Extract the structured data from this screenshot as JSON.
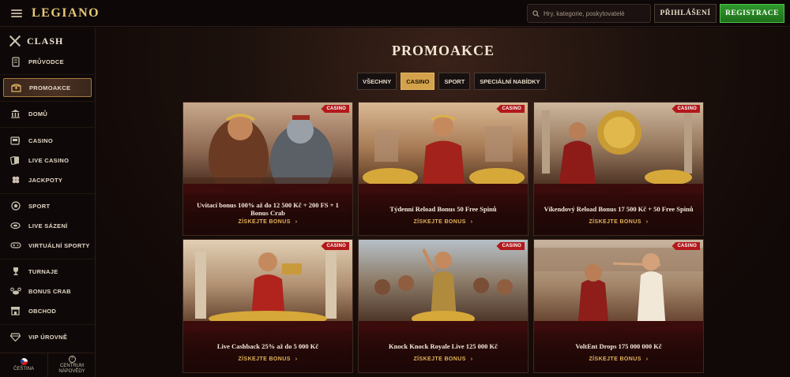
{
  "header": {
    "logo": "LEGIANO",
    "search_placeholder": "Hry, kategorie, poskytovatelé",
    "login_label": "PŘIHLÁŠENÍ",
    "register_label": "REGISTRACE"
  },
  "sidebar": {
    "clash_label": "CLASH",
    "items": [
      {
        "label": "PRŮVODCE",
        "icon": "scroll-icon"
      },
      {
        "label": "PROMOAKCE",
        "icon": "treasure-chest-icon"
      },
      {
        "label": "DOMŮ",
        "icon": "temple-icon"
      },
      {
        "label": "CASINO",
        "icon": "slot-machine-icon"
      },
      {
        "label": "LIVE CASINO",
        "icon": "cards-icon"
      },
      {
        "label": "JACKPOTY",
        "icon": "clover-icon"
      },
      {
        "label": "SPORT",
        "icon": "ball-icon"
      },
      {
        "label": "LIVE SÁZENÍ",
        "icon": "live-stadium-icon"
      },
      {
        "label": "VIRTUÁLNÍ SPORTY",
        "icon": "gamepad-icon"
      },
      {
        "label": "TURNAJE",
        "icon": "trophy-icon"
      },
      {
        "label": "BONUS CRAB",
        "icon": "crab-icon"
      },
      {
        "label": "OBCHOD",
        "icon": "shop-icon"
      },
      {
        "label": "VIP ÚROVNĚ",
        "icon": "diamond-icon"
      }
    ],
    "language": "ČEŠTINA",
    "help_line1": "CENTRUM",
    "help_line2": "NÁPOVĚDY"
  },
  "main": {
    "title": "PROMOAKCE",
    "filters": [
      {
        "label": "VŠECHNY",
        "active": false
      },
      {
        "label": "CASINO",
        "active": true
      },
      {
        "label": "SPORT",
        "active": false
      },
      {
        "label": "SPECIÁLNÍ NABÍDKY",
        "active": false
      }
    ],
    "cards": [
      {
        "badge": "CASINO",
        "title": "Uvítací bonus 100% až do 12 500 Kč + 200 FS + 1 Bonus Crab",
        "link": "ZÍSKEJTE BONUS"
      },
      {
        "badge": "CASINO",
        "title": "Týdenní Reload Bonus 50 Free Spinů",
        "link": "ZÍSKEJTE BONUS"
      },
      {
        "badge": "CASINO",
        "title": "Víkendový Reload Bonus 17 500 Kč + 50 Free Spinů",
        "link": "ZÍSKEJTE BONUS"
      },
      {
        "badge": "CASINO",
        "title": "Live Cashback 25% až do 5 000 Kč",
        "link": "ZÍSKEJTE BONUS"
      },
      {
        "badge": "CASINO",
        "title": "Knock Knock Royale Live 125 000 Kč",
        "link": "ZÍSKEJTE BONUS"
      },
      {
        "badge": "CASINO",
        "title": "VoltEnt Drops 175 000 000 Kč",
        "link": "ZÍSKEJTE BONUS"
      }
    ]
  },
  "colors": {
    "accent_gold": "#d3a24a",
    "register_green": "#2f9a2c",
    "badge_red": "#b3181b"
  }
}
